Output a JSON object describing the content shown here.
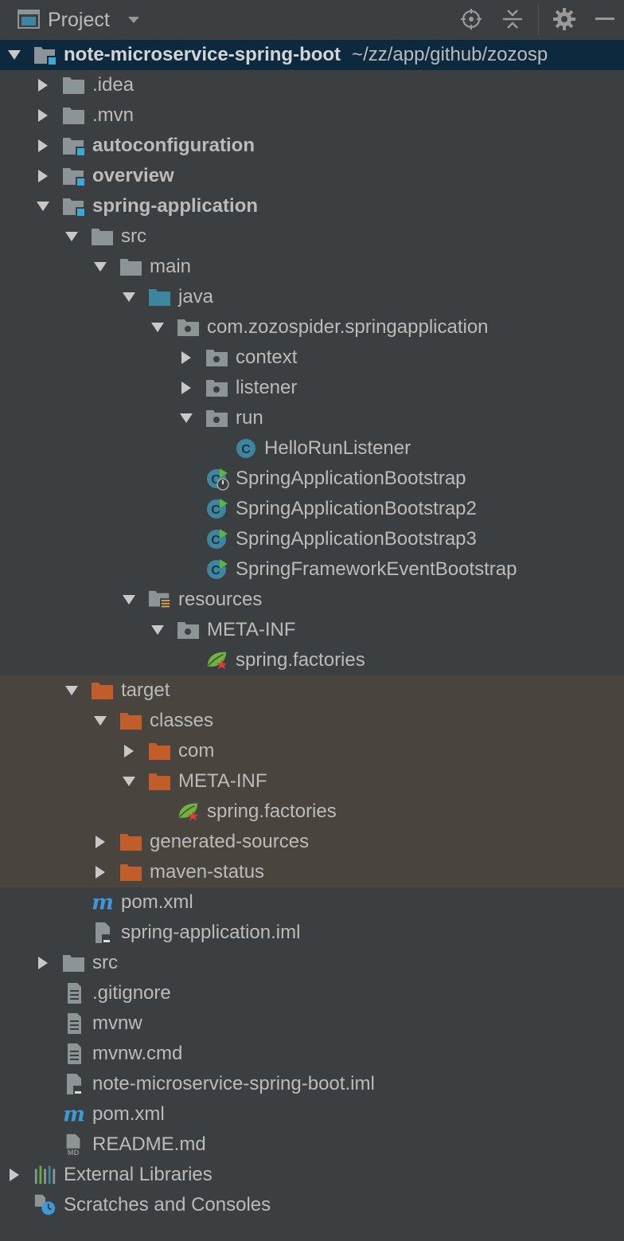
{
  "header": {
    "title": "Project",
    "icons": [
      "project-view-icon",
      "dropdown-caret-icon",
      "locate-icon",
      "collapse-all-icon",
      "gear-icon",
      "minimize-icon"
    ]
  },
  "colors": {
    "folder": "#8c9497",
    "source_folder": "#3e86a0",
    "excluded_folder": "#c15c2b",
    "class_icon": "#3e86a0",
    "run_arrow": "#5fb340",
    "spring_leaf": "#6db33f",
    "selection": "#0d293e",
    "excluded_band": "#49453e",
    "module_badge": "#40a6d6"
  },
  "tree": {
    "root": {
      "name": "note-microservice-spring-boot",
      "path": "~/zz/app/github/zozosp"
    },
    "items": [
      {
        "label": ".idea"
      },
      {
        "label": ".mvn"
      },
      {
        "label": "autoconfiguration"
      },
      {
        "label": "overview"
      },
      {
        "label": "spring-application"
      },
      {
        "label": "src"
      },
      {
        "label": "main"
      },
      {
        "label": "java"
      },
      {
        "label": "com.zozospider.springapplication"
      },
      {
        "label": "context"
      },
      {
        "label": "listener"
      },
      {
        "label": "run"
      },
      {
        "label": "HelloRunListener"
      },
      {
        "label": "SpringApplicationBootstrap"
      },
      {
        "label": "SpringApplicationBootstrap2"
      },
      {
        "label": "SpringApplicationBootstrap3"
      },
      {
        "label": "SpringFrameworkEventBootstrap"
      },
      {
        "label": "resources"
      },
      {
        "label": "META-INF"
      },
      {
        "label": "spring.factories"
      },
      {
        "label": "target"
      },
      {
        "label": "classes"
      },
      {
        "label": "com"
      },
      {
        "label": "META-INF"
      },
      {
        "label": "spring.factories"
      },
      {
        "label": "generated-sources"
      },
      {
        "label": "maven-status"
      },
      {
        "label": "pom.xml"
      },
      {
        "label": "spring-application.iml"
      },
      {
        "label": "src"
      },
      {
        "label": ".gitignore"
      },
      {
        "label": "mvnw"
      },
      {
        "label": "mvnw.cmd"
      },
      {
        "label": "note-microservice-spring-boot.iml"
      },
      {
        "label": "pom.xml"
      },
      {
        "label": "README.md"
      },
      {
        "label": "External Libraries"
      },
      {
        "label": "Scratches and Consoles"
      }
    ]
  }
}
